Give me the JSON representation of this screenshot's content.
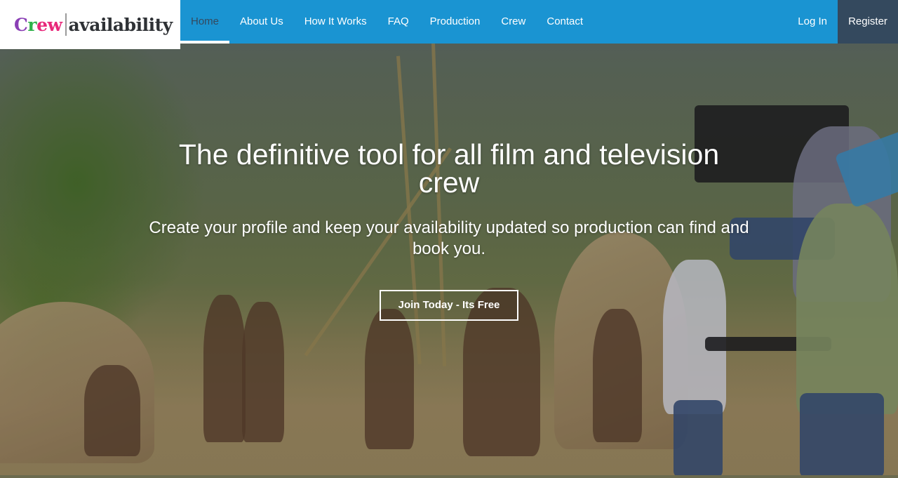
{
  "logo": {
    "part1_c": "C",
    "part1_r": "r",
    "part1_ew": "ew",
    "part2": "availability"
  },
  "nav": {
    "items": [
      {
        "label": "Home",
        "active": true
      },
      {
        "label": "About Us"
      },
      {
        "label": "How It Works"
      },
      {
        "label": "FAQ"
      },
      {
        "label": "Production"
      },
      {
        "label": "Crew"
      },
      {
        "label": "Contact"
      }
    ],
    "login_label": "Log In",
    "register_label": "Register"
  },
  "hero": {
    "title": "The definitive tool for all film and television crew",
    "subtitle": "Create your profile and keep your availability updated so production can find and book you.",
    "cta_label": "Join Today - Its Free",
    "background_image": "film-crew-on-set-photo"
  },
  "colors": {
    "nav_bg": "#1a94d2",
    "register_bg": "#34495e",
    "active_nav_text": "#34495e",
    "logo_purple": "#8a3fb5",
    "logo_green": "#2fb24a",
    "logo_pink": "#e8297a"
  }
}
